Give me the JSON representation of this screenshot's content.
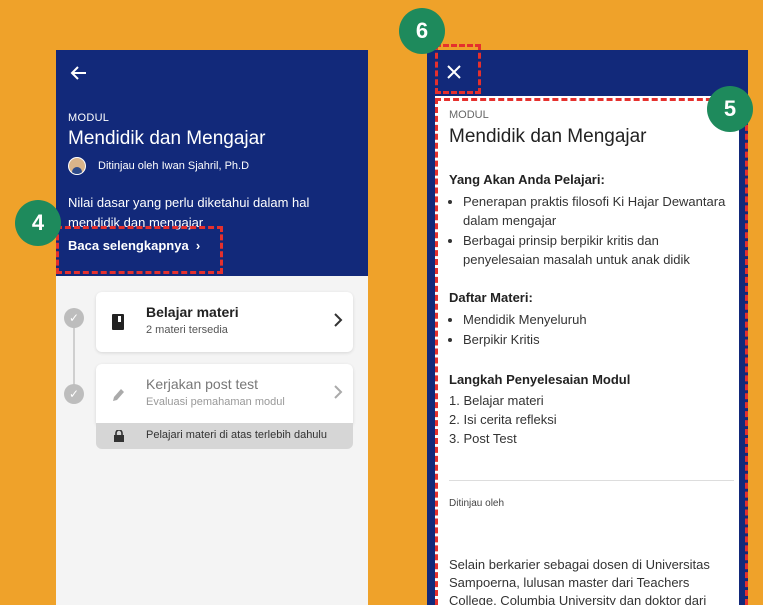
{
  "module_screen": {
    "label": "MODUL",
    "title": "Mendidik dan Mengajar",
    "reviewer_text": "Ditinjau oleh Iwan Sjahril, Ph.D",
    "description": "Nilai dasar yang perlu diketahui dalam hal mendidik dan mengajar",
    "read_more": "Baca selengkapnya",
    "steps": [
      {
        "title": "Belajar materi",
        "subtitle": "2 materi tersedia"
      },
      {
        "title": "Kerjakan post test",
        "subtitle": "Evaluasi pemahaman modul"
      }
    ],
    "lock_text": "Pelajari materi di atas terlebih dahulu"
  },
  "detail_screen": {
    "label": "MODUL",
    "title": "Mendidik dan Mengajar",
    "learn_heading": "Yang Akan Anda Pelajari:",
    "learn_items": [
      "Penerapan praktis filosofi Ki Hajar Dewantara dalam mengajar",
      "Berbagai prinsip berpikir kritis dan penyelesaian masalah untuk anak didik"
    ],
    "materials_heading": "Daftar Materi:",
    "materials": [
      "Mendidik Menyeluruh",
      "Berpikir Kritis"
    ],
    "steps_heading": "Langkah Penyelesaian Modul",
    "steps": [
      "1. Belajar materi",
      "2. Isi cerita refleksi",
      "3. Post Test"
    ],
    "reviewed_by": "Ditinjau oleh",
    "bio": "Selain berkarier sebagai dosen di Universitas Sampoerna, lulusan master dari Teachers College, Columbia University dan doktor dari"
  },
  "callouts": [
    "4",
    "5",
    "6"
  ],
  "icons": {
    "back": "arrow-left-icon",
    "close": "close-icon",
    "book": "book-icon",
    "pencil": "pencil-icon",
    "lock": "lock-icon",
    "check": "check-circle-icon",
    "chevron": "chevron-right-icon"
  },
  "colors": {
    "background": "#EFA22A",
    "header": "#12297A",
    "callout_badge": "#1E8A5C",
    "callout_border": "#E5302D"
  }
}
